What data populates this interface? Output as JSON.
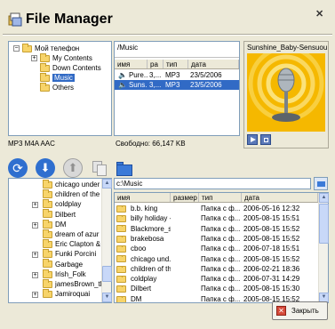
{
  "window": {
    "title": "File Manager",
    "close_glyph": "✕"
  },
  "phone_tree": {
    "root": "Мой телефон",
    "items": [
      "My Contents",
      "Down Contents",
      "Music",
      "Others"
    ],
    "selected": "Music"
  },
  "music_list": {
    "path": "/Music",
    "columns": [
      "имя",
      "ра",
      "тип",
      "дата"
    ],
    "rows": [
      {
        "name": "Pure...",
        "size": "3,...",
        "type": "MP3",
        "date": "23/5/2006"
      },
      {
        "name": "Suns...",
        "size": "3,...",
        "type": "MP3",
        "date": "23/5/2006"
      }
    ]
  },
  "preview": {
    "title": "Sunshine_Baby-Sensuous."
  },
  "status": {
    "formats": "MP3 M4A AAC",
    "free": "Свободно: 66,147 KB"
  },
  "pc_tree": {
    "items": [
      {
        "label": "chicago under",
        "expand": false
      },
      {
        "label": "children of the",
        "expand": false
      },
      {
        "label": "coldplay",
        "expand": true
      },
      {
        "label": "Dilbert",
        "expand": false
      },
      {
        "label": "DM",
        "expand": true
      },
      {
        "label": "dream of azur",
        "expand": false
      },
      {
        "label": "Eric Clapton &",
        "expand": false
      },
      {
        "label": "Funki Porcini",
        "expand": true
      },
      {
        "label": "Garbage",
        "expand": false
      },
      {
        "label": "Irish_Folk",
        "expand": true
      },
      {
        "label": "jamesBrown_th",
        "expand": false
      },
      {
        "label": "Jamiroquai",
        "expand": true
      }
    ]
  },
  "pc_list": {
    "path": "c:\\Music",
    "columns": [
      "имя",
      "размер",
      "тип",
      "дата"
    ],
    "rows": [
      {
        "name": "b.b. king",
        "size": "",
        "type": "Папка с ф...",
        "date": "2006-05-16 12:32"
      },
      {
        "name": "billy holiday -...",
        "size": "",
        "type": "Папка с ф...",
        "date": "2005-08-15 15:51"
      },
      {
        "name": "Blackmore_s...",
        "size": "",
        "type": "Папка с ф...",
        "date": "2005-08-15 15:52"
      },
      {
        "name": "brakebosa",
        "size": "",
        "type": "Папка с ф...",
        "date": "2005-08-15 15:52"
      },
      {
        "name": "cboo",
        "size": "",
        "type": "Папка с ф...",
        "date": "2006-07-18 15:51"
      },
      {
        "name": "chicago und...",
        "size": "",
        "type": "Папка с ф...",
        "date": "2005-08-15 15:52"
      },
      {
        "name": "children of th...",
        "size": "",
        "type": "Папка с ф...",
        "date": "2006-02-21 18:36"
      },
      {
        "name": "coldplay",
        "size": "",
        "type": "Папка с ф...",
        "date": "2006-07-31 14:29"
      },
      {
        "name": "Dilbert",
        "size": "",
        "type": "Папка с ф...",
        "date": "2005-08-15 15:30"
      },
      {
        "name": "DM",
        "size": "",
        "type": "Папка с ф...",
        "date": "2005-08-15 15:52"
      }
    ]
  },
  "footer": {
    "close_label": "Закрыть"
  }
}
